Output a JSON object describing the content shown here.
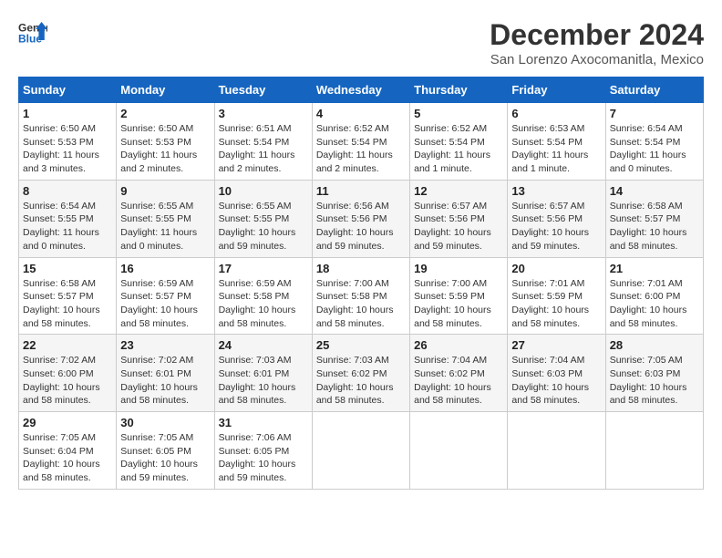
{
  "header": {
    "logo_line1": "General",
    "logo_line2": "Blue",
    "main_title": "December 2024",
    "subtitle": "San Lorenzo Axocomanitla, Mexico"
  },
  "calendar": {
    "days_of_week": [
      "Sunday",
      "Monday",
      "Tuesday",
      "Wednesday",
      "Thursday",
      "Friday",
      "Saturday"
    ],
    "weeks": [
      [
        {
          "day": "1",
          "info": "Sunrise: 6:50 AM\nSunset: 5:53 PM\nDaylight: 11 hours\nand 3 minutes."
        },
        {
          "day": "2",
          "info": "Sunrise: 6:50 AM\nSunset: 5:53 PM\nDaylight: 11 hours\nand 2 minutes."
        },
        {
          "day": "3",
          "info": "Sunrise: 6:51 AM\nSunset: 5:54 PM\nDaylight: 11 hours\nand 2 minutes."
        },
        {
          "day": "4",
          "info": "Sunrise: 6:52 AM\nSunset: 5:54 PM\nDaylight: 11 hours\nand 2 minutes."
        },
        {
          "day": "5",
          "info": "Sunrise: 6:52 AM\nSunset: 5:54 PM\nDaylight: 11 hours\nand 1 minute."
        },
        {
          "day": "6",
          "info": "Sunrise: 6:53 AM\nSunset: 5:54 PM\nDaylight: 11 hours\nand 1 minute."
        },
        {
          "day": "7",
          "info": "Sunrise: 6:54 AM\nSunset: 5:54 PM\nDaylight: 11 hours\nand 0 minutes."
        }
      ],
      [
        {
          "day": "8",
          "info": "Sunrise: 6:54 AM\nSunset: 5:55 PM\nDaylight: 11 hours\nand 0 minutes."
        },
        {
          "day": "9",
          "info": "Sunrise: 6:55 AM\nSunset: 5:55 PM\nDaylight: 11 hours\nand 0 minutes."
        },
        {
          "day": "10",
          "info": "Sunrise: 6:55 AM\nSunset: 5:55 PM\nDaylight: 10 hours\nand 59 minutes."
        },
        {
          "day": "11",
          "info": "Sunrise: 6:56 AM\nSunset: 5:56 PM\nDaylight: 10 hours\nand 59 minutes."
        },
        {
          "day": "12",
          "info": "Sunrise: 6:57 AM\nSunset: 5:56 PM\nDaylight: 10 hours\nand 59 minutes."
        },
        {
          "day": "13",
          "info": "Sunrise: 6:57 AM\nSunset: 5:56 PM\nDaylight: 10 hours\nand 59 minutes."
        },
        {
          "day": "14",
          "info": "Sunrise: 6:58 AM\nSunset: 5:57 PM\nDaylight: 10 hours\nand 58 minutes."
        }
      ],
      [
        {
          "day": "15",
          "info": "Sunrise: 6:58 AM\nSunset: 5:57 PM\nDaylight: 10 hours\nand 58 minutes."
        },
        {
          "day": "16",
          "info": "Sunrise: 6:59 AM\nSunset: 5:57 PM\nDaylight: 10 hours\nand 58 minutes."
        },
        {
          "day": "17",
          "info": "Sunrise: 6:59 AM\nSunset: 5:58 PM\nDaylight: 10 hours\nand 58 minutes."
        },
        {
          "day": "18",
          "info": "Sunrise: 7:00 AM\nSunset: 5:58 PM\nDaylight: 10 hours\nand 58 minutes."
        },
        {
          "day": "19",
          "info": "Sunrise: 7:00 AM\nSunset: 5:59 PM\nDaylight: 10 hours\nand 58 minutes."
        },
        {
          "day": "20",
          "info": "Sunrise: 7:01 AM\nSunset: 5:59 PM\nDaylight: 10 hours\nand 58 minutes."
        },
        {
          "day": "21",
          "info": "Sunrise: 7:01 AM\nSunset: 6:00 PM\nDaylight: 10 hours\nand 58 minutes."
        }
      ],
      [
        {
          "day": "22",
          "info": "Sunrise: 7:02 AM\nSunset: 6:00 PM\nDaylight: 10 hours\nand 58 minutes."
        },
        {
          "day": "23",
          "info": "Sunrise: 7:02 AM\nSunset: 6:01 PM\nDaylight: 10 hours\nand 58 minutes."
        },
        {
          "day": "24",
          "info": "Sunrise: 7:03 AM\nSunset: 6:01 PM\nDaylight: 10 hours\nand 58 minutes."
        },
        {
          "day": "25",
          "info": "Sunrise: 7:03 AM\nSunset: 6:02 PM\nDaylight: 10 hours\nand 58 minutes."
        },
        {
          "day": "26",
          "info": "Sunrise: 7:04 AM\nSunset: 6:02 PM\nDaylight: 10 hours\nand 58 minutes."
        },
        {
          "day": "27",
          "info": "Sunrise: 7:04 AM\nSunset: 6:03 PM\nDaylight: 10 hours\nand 58 minutes."
        },
        {
          "day": "28",
          "info": "Sunrise: 7:05 AM\nSunset: 6:03 PM\nDaylight: 10 hours\nand 58 minutes."
        }
      ],
      [
        {
          "day": "29",
          "info": "Sunrise: 7:05 AM\nSunset: 6:04 PM\nDaylight: 10 hours\nand 58 minutes."
        },
        {
          "day": "30",
          "info": "Sunrise: 7:05 AM\nSunset: 6:05 PM\nDaylight: 10 hours\nand 59 minutes."
        },
        {
          "day": "31",
          "info": "Sunrise: 7:06 AM\nSunset: 6:05 PM\nDaylight: 10 hours\nand 59 minutes."
        },
        {
          "day": "",
          "info": ""
        },
        {
          "day": "",
          "info": ""
        },
        {
          "day": "",
          "info": ""
        },
        {
          "day": "",
          "info": ""
        }
      ]
    ]
  }
}
